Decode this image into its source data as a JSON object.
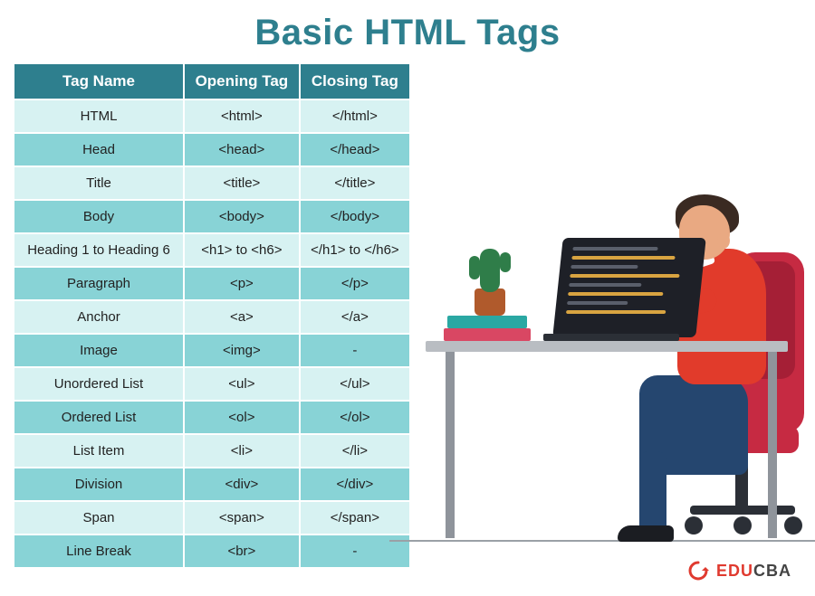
{
  "title": "Basic HTML Tags",
  "columns": [
    "Tag Name",
    "Opening Tag",
    "Closing Tag"
  ],
  "rows": [
    {
      "name": "HTML",
      "open": "<html>",
      "close": "</html>"
    },
    {
      "name": "Head",
      "open": "<head>",
      "close": "</head>"
    },
    {
      "name": "Title",
      "open": "<title>",
      "close": "</title>"
    },
    {
      "name": "Body",
      "open": "<body>",
      "close": "</body>"
    },
    {
      "name": "Heading 1 to Heading 6",
      "open": "<h1> to <h6>",
      "close": "</h1> to </h6>"
    },
    {
      "name": "Paragraph",
      "open": "<p>",
      "close": "</p>"
    },
    {
      "name": "Anchor",
      "open": "<a>",
      "close": "</a>"
    },
    {
      "name": "Image",
      "open": "<img>",
      "close": "-"
    },
    {
      "name": "Unordered List",
      "open": "<ul>",
      "close": "</ul>"
    },
    {
      "name": "Ordered List",
      "open": "<ol>",
      "close": "</ol>"
    },
    {
      "name": "List Item",
      "open": "<li>",
      "close": "</li>"
    },
    {
      "name": "Division",
      "open": "<div>",
      "close": "</div>"
    },
    {
      "name": "Span",
      "open": "<span>",
      "close": "</span>"
    },
    {
      "name": "Line Break",
      "open": "<br>",
      "close": "-"
    }
  ],
  "logo": {
    "accent": "EDU",
    "rest": "CBA"
  }
}
